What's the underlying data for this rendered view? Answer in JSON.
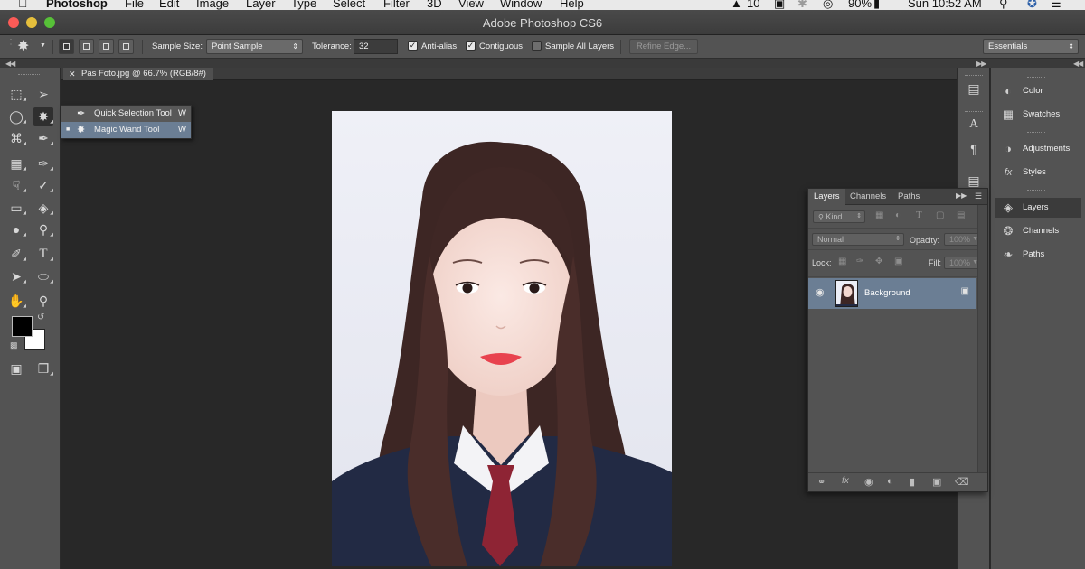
{
  "menubar": {
    "app": "Photoshop",
    "menus": [
      "File",
      "Edit",
      "Image",
      "Layer",
      "Type",
      "Select",
      "Filter",
      "3D",
      "View",
      "Window",
      "Help"
    ],
    "status": {
      "adobe_count": "10",
      "battery": "90%",
      "clock": "Sun 10:52 AM"
    }
  },
  "window": {
    "title": "Adobe Photoshop CS6"
  },
  "options": {
    "sample_size_label": "Sample Size:",
    "sample_size_value": "Point Sample",
    "tolerance_label": "Tolerance:",
    "tolerance_value": "32",
    "anti_alias_label": "Anti-alias",
    "contiguous_label": "Contiguous",
    "sample_all_layers_label": "Sample All Layers",
    "refine_edge_label": "Refine Edge...",
    "workspace": "Essentials"
  },
  "flyout": {
    "items": [
      {
        "name": "Quick Selection Tool",
        "key": "W"
      },
      {
        "name": "Magic Wand Tool",
        "key": "W"
      }
    ]
  },
  "document": {
    "tab_title": "Pas Foto.jpg @ 66.7% (RGB/8#)"
  },
  "dock": {
    "items": [
      "Color",
      "Swatches",
      "Adjustments",
      "Styles",
      "Layers",
      "Channels",
      "Paths"
    ]
  },
  "layers_panel": {
    "tabs": [
      "Layers",
      "Channels",
      "Paths"
    ],
    "kind_label": "Kind",
    "blend_mode": "Normal",
    "opacity_label": "Opacity:",
    "opacity_value": "100%",
    "lock_label": "Lock:",
    "fill_label": "Fill:",
    "fill_value": "100%",
    "layer_name": "Background"
  },
  "colors": {
    "accent_selection": "#6b7e94",
    "foreground": "#000000",
    "background": "#ffffff",
    "lip": "#e8424e"
  }
}
